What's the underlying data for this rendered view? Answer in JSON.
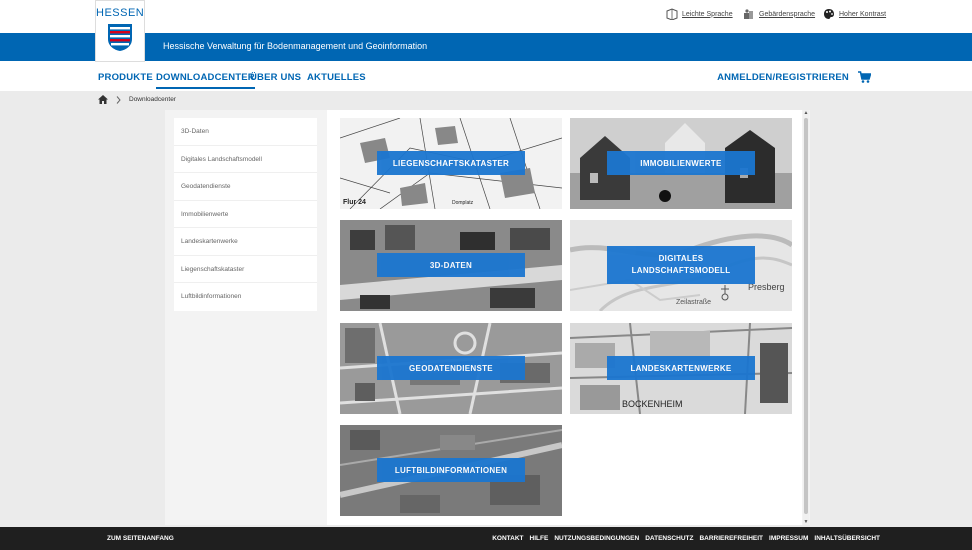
{
  "header": {
    "logo_text": "HESSEN",
    "subtitle": "Hessische Verwaltung für Bodenmanagement und Geoinformation",
    "accessibility": [
      {
        "label": "Leichte Sprache",
        "icon": "easy-language-icon"
      },
      {
        "label": "Gebärdensprache",
        "icon": "sign-language-icon"
      },
      {
        "label": "Hoher Kontrast",
        "icon": "contrast-palette-icon"
      }
    ],
    "brand_color": "#0066b3"
  },
  "nav": {
    "items": [
      "PRODUKTE",
      "DOWNLOADCENTER",
      "ÜBER UNS",
      "AKTUELLES"
    ],
    "active": "DOWNLOADCENTER",
    "login": "ANMELDEN/REGISTRIEREN",
    "cart_icon": "cart-icon"
  },
  "breadcrumb": {
    "home_icon": "home-icon",
    "current": "Downloadcenter"
  },
  "sidebar": {
    "items": [
      "3D-Daten",
      "Digitales Landschaftsmodell",
      "Geodatendienste",
      "Immobilienwerte",
      "Landeskartenwerke",
      "Liegenschaftskataster",
      "Luftbildinformationen"
    ]
  },
  "tiles": [
    {
      "label": "LIEGENSCHAFTSKATASTER",
      "map_text_1": "Flur 24",
      "map_text_2": "Domplatz"
    },
    {
      "label": "IMMOBILIENWERTE"
    },
    {
      "label": "3D-DATEN"
    },
    {
      "label": "DIGITALES LANDSCHAFTSMODELL",
      "map_text_1": "Presberg",
      "map_text_2": "Zeilastraße"
    },
    {
      "label": "GEODATENDIENSTE"
    },
    {
      "label": "LANDESKARTENWERKE",
      "map_text_1": "BOCKENHEIM"
    },
    {
      "label": "LUFTBILDINFORMATIONEN"
    }
  ],
  "footer": {
    "top_link": "ZUM SEITENANFANG",
    "links": [
      "KONTAKT",
      "HILFE",
      "NUTZUNGSBEDINGUNGEN",
      "DATENSCHUTZ",
      "BARRIEREFREIHEIT",
      "IMPRESSUM",
      "INHALTSÜBERSICHT"
    ]
  }
}
